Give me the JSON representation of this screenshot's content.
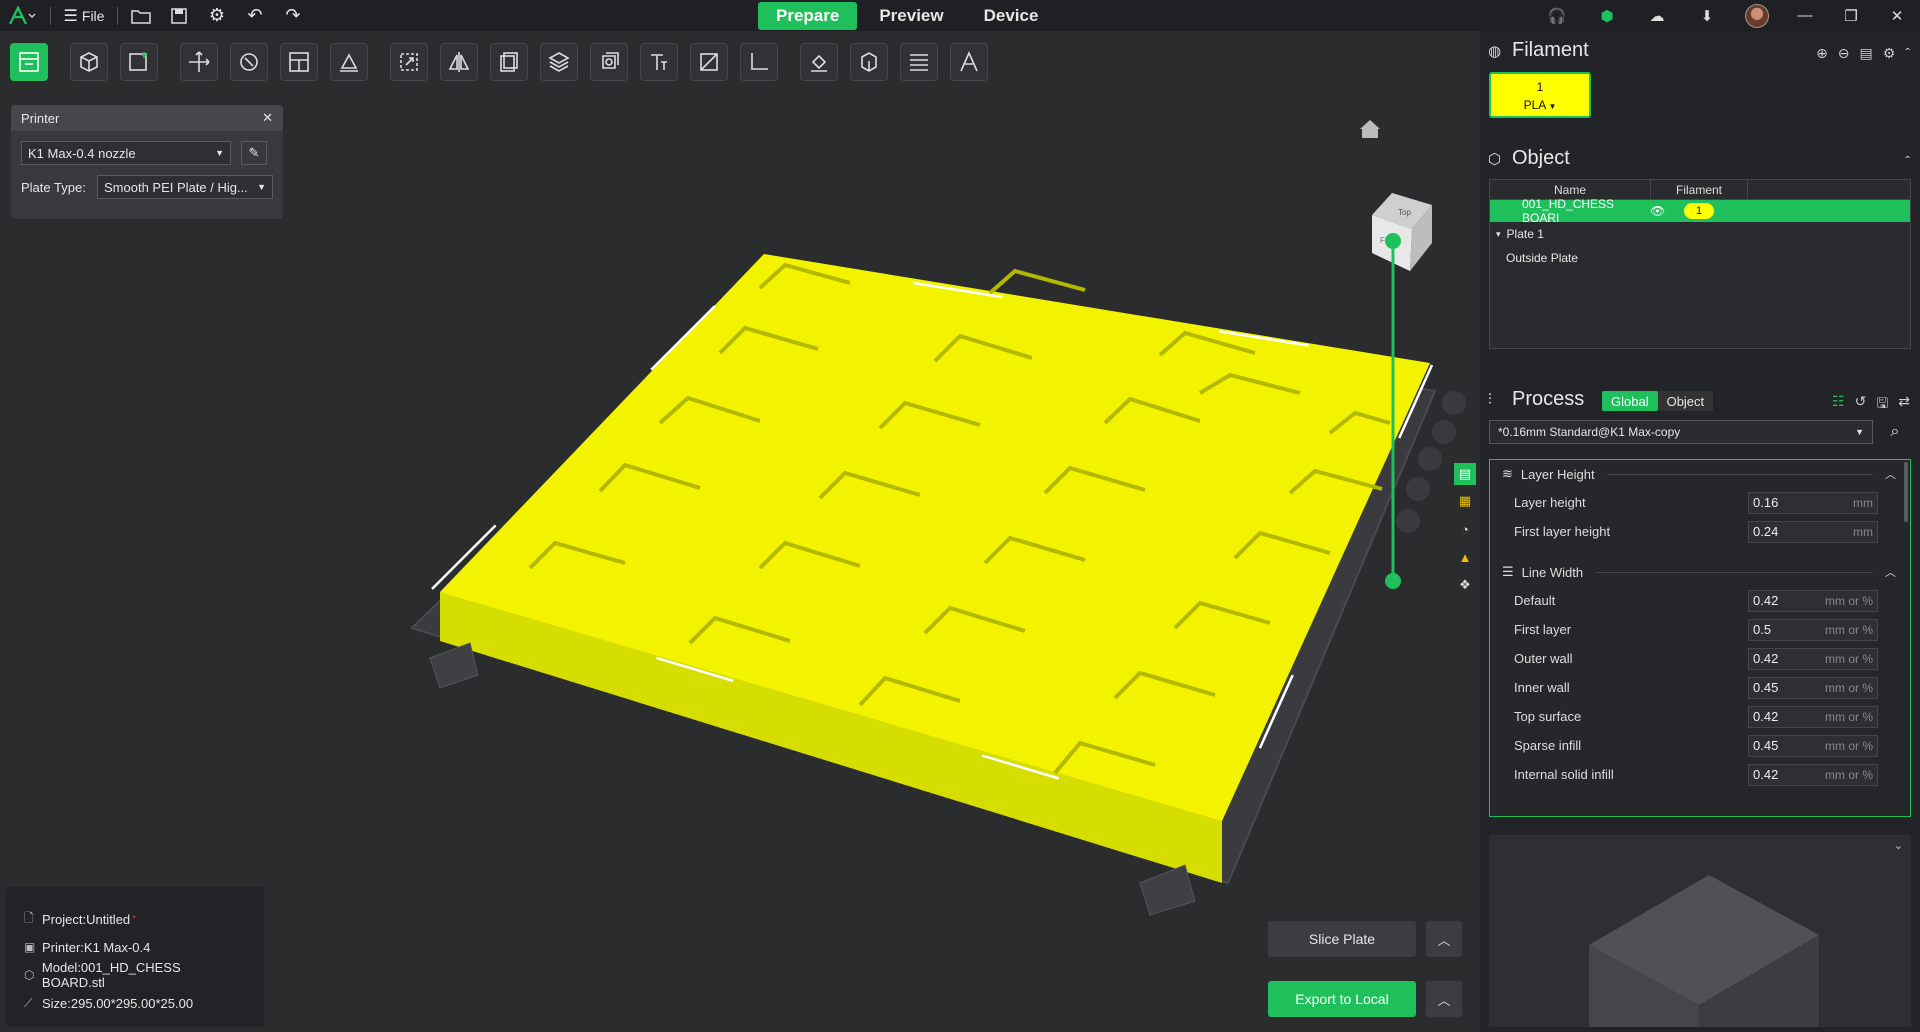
{
  "title_bar": {
    "file_label": "File",
    "tabs": [
      {
        "label": "Prepare",
        "active": true
      },
      {
        "label": "Preview",
        "active": false
      },
      {
        "label": "Device",
        "active": false
      }
    ]
  },
  "colors": {
    "accent": "#1fc05c",
    "model_yellow": "#ffff00",
    "background": "#2b2c2e"
  },
  "toolbar": {
    "icons": [
      "arrange-plate-icon",
      "add-cube-icon",
      "add-plate-icon",
      "auto-orient-icon",
      "rotate-icon",
      "split-layout-icon",
      "erase-icon",
      "scale-icon",
      "mirror-icon",
      "copy-icon",
      "layers-icon",
      "hollow-icon",
      "text-icon",
      "cut-icon",
      "measure-icon",
      "support-paint-icon",
      "cube-outline-icon",
      "variable-layer-icon",
      "assembly-icon"
    ]
  },
  "printer_panel": {
    "title": "Printer",
    "printer": "K1 Max-0.4 nozzle",
    "plate_type_label": "Plate Type:",
    "plate_type": "Smooth PEI Plate / Hig..."
  },
  "view_cube": {
    "top": "Top",
    "front": "Front"
  },
  "info": {
    "project": "Project:Untitled",
    "modified_marker": "*",
    "printer": "Printer:K1 Max-0.4",
    "model": "Model:001_HD_CHESS BOARD.stl",
    "size": "Size:295.00*295.00*25.00"
  },
  "actions": {
    "slice": "Slice Plate",
    "export": "Export to Local"
  },
  "filament": {
    "title": "Filament",
    "slot_number": "1",
    "slot_type": "PLA"
  },
  "object": {
    "title": "Object",
    "col_name": "Name",
    "col_filament": "Filament",
    "selected_name": "001_HD_CHESS BOARI",
    "selected_filament": "1",
    "rows": [
      "Plate 1",
      "Outside Plate"
    ]
  },
  "process": {
    "title": "Process",
    "global": "Global",
    "object": "Object",
    "preset": "*0.16mm Standard@K1 Max-copy",
    "groups": [
      {
        "name": "Layer Height",
        "rows": [
          {
            "label": "Layer height",
            "value": "0.16",
            "unit": "mm"
          },
          {
            "label": "First layer height",
            "value": "0.24",
            "unit": "mm"
          }
        ]
      },
      {
        "name": "Line Width",
        "rows": [
          {
            "label": "Default",
            "value": "0.42",
            "unit": "mm or %"
          },
          {
            "label": "First layer",
            "value": "0.5",
            "unit": "mm or %"
          },
          {
            "label": "Outer wall",
            "value": "0.42",
            "unit": "mm or %"
          },
          {
            "label": "Inner wall",
            "value": "0.45",
            "unit": "mm or %"
          },
          {
            "label": "Top surface",
            "value": "0.42",
            "unit": "mm or %"
          },
          {
            "label": "Sparse infill",
            "value": "0.45",
            "unit": "mm or %"
          },
          {
            "label": "Internal solid infill",
            "value": "0.42",
            "unit": "mm or %"
          }
        ]
      }
    ]
  }
}
